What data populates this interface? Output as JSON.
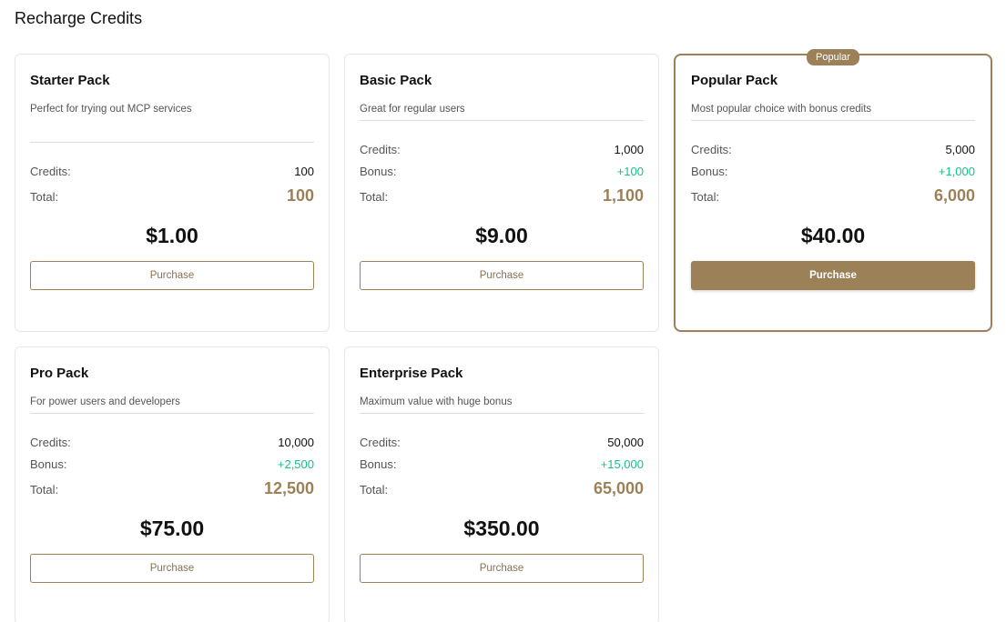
{
  "page": {
    "title": "Recharge Credits"
  },
  "labels": {
    "credits": "Credits:",
    "bonus": "Bonus:",
    "total": "Total:",
    "purchase": "Purchase",
    "popular_badge": "Popular"
  },
  "colors": {
    "accent": "#9b8058",
    "bonus": "#15c38a"
  },
  "packs": [
    {
      "name": "Starter Pack",
      "description": "Perfect for trying out MCP services",
      "credits": "100",
      "bonus": "",
      "total": "100",
      "price": "$1.00"
    },
    {
      "name": "Basic Pack",
      "description": "Great for regular users",
      "credits": "1,000",
      "bonus": "+100",
      "total": "1,100",
      "price": "$9.00"
    },
    {
      "name": "Popular Pack",
      "description": "Most popular choice with bonus credits",
      "credits": "5,000",
      "bonus": "+1,000",
      "total": "6,000",
      "price": "$40.00",
      "popular": true
    },
    {
      "name": "Pro Pack",
      "description": "For power users and developers",
      "credits": "10,000",
      "bonus": "+2,500",
      "total": "12,500",
      "price": "$75.00"
    },
    {
      "name": "Enterprise Pack",
      "description": "Maximum value with huge bonus",
      "credits": "50,000",
      "bonus": "+15,000",
      "total": "65,000",
      "price": "$350.00"
    }
  ]
}
